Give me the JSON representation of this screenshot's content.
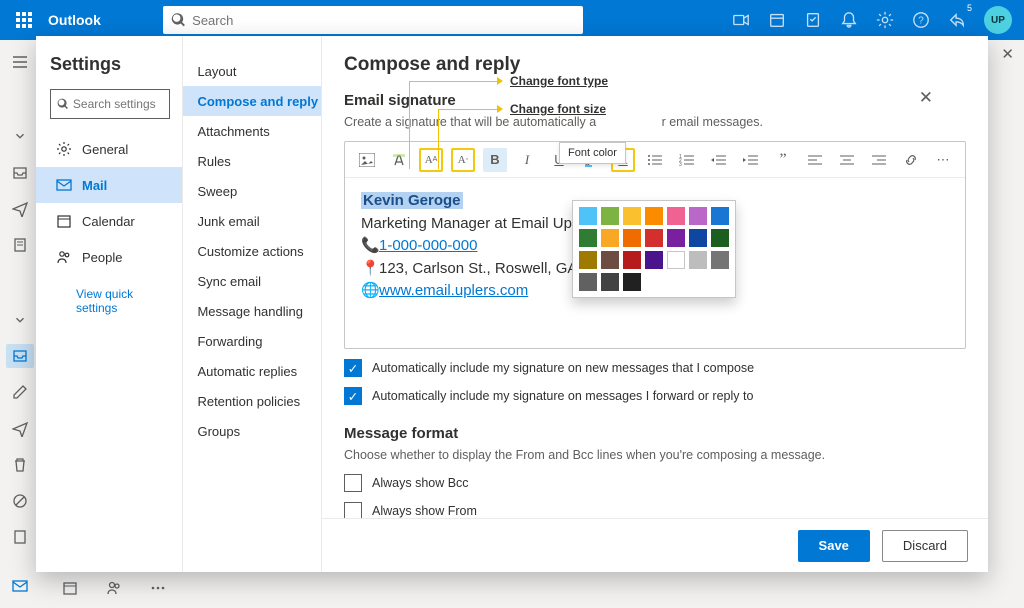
{
  "app": {
    "name": "Outlook",
    "search_placeholder": "Search",
    "notification_count": "5"
  },
  "annotations": {
    "font_type": "Change font type",
    "font_size": "Change font size"
  },
  "tooltip": {
    "font_color": "Font color"
  },
  "settings": {
    "title": "Settings",
    "search_placeholder": "Search settings",
    "nav": {
      "general": "General",
      "mail": "Mail",
      "calendar": "Calendar",
      "people": "People"
    },
    "quick_link": "View quick settings"
  },
  "mail_menu": {
    "layout": "Layout",
    "compose": "Compose and reply",
    "attachments": "Attachments",
    "rules": "Rules",
    "sweep": "Sweep",
    "junk": "Junk email",
    "customize": "Customize actions",
    "sync": "Sync email",
    "handling": "Message handling",
    "forwarding": "Forwarding",
    "autoreply": "Automatic replies",
    "retention": "Retention policies",
    "groups": "Groups"
  },
  "compose": {
    "title": "Compose and reply",
    "sig_heading": "Email signature",
    "sig_desc_a": "Create a signature that will be automatically a",
    "sig_desc_b": "r email messages.",
    "signature": {
      "name": "Kevin Geroge",
      "title": "Marketing Manager at Email Up",
      "phone": "1-000-000-000",
      "address": "123, Carlson St., Roswell, GA",
      "website": "www.email.uplers.com"
    },
    "chk1": "Automatically include my signature on new messages that I compose",
    "chk2": "Automatically include my signature on messages I forward or reply to",
    "msgfmt_heading": "Message format",
    "msgfmt_desc": "Choose whether to display the From and Bcc lines when you're composing a message.",
    "chk3": "Always show Bcc",
    "chk4": "Always show From"
  },
  "buttons": {
    "save": "Save",
    "discard": "Discard"
  },
  "color_picker": {
    "rows": [
      [
        "#4fc3f7",
        "#7cb342",
        "#fbc02d",
        "#fb8c00",
        "#f06292",
        "#ba68c8",
        ""
      ],
      [
        "#1976d2",
        "#2e7d32",
        "#f9a825",
        "#ef6c00",
        "#d32f2f",
        "#7b1fa2",
        ""
      ],
      [
        "#0d47a1",
        "#1b5e20",
        "#9e7b00",
        "#6d4c41",
        "#b71c1c",
        "#4a148c",
        ""
      ],
      [
        "empty",
        "#bdbdbd",
        "#757575",
        "#616161",
        "#424242",
        "#212121",
        ""
      ]
    ]
  }
}
